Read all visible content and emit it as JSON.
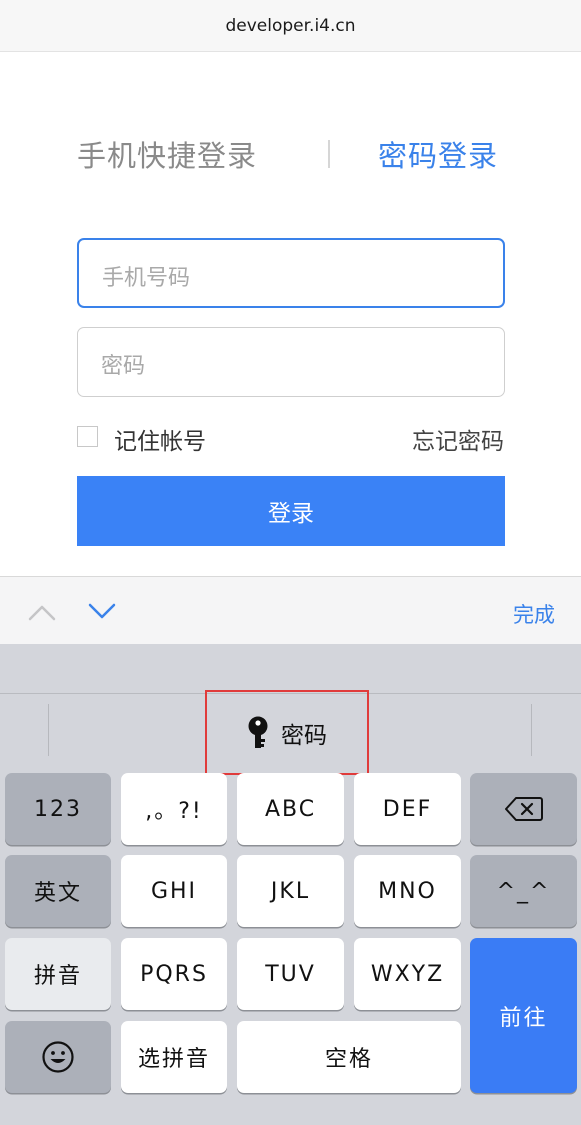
{
  "browser": {
    "url": "developer.i4.cn"
  },
  "login": {
    "tab_quick": "手机快捷登录",
    "tab_password": "密码登录",
    "phone_placeholder": "手机号码",
    "password_placeholder": "密码",
    "remember_label": "记住帐号",
    "forgot_label": "忘记密码",
    "login_button": "登录"
  },
  "accessory": {
    "done_label": "完成"
  },
  "keyboard": {
    "suggestion": "密码",
    "keys": {
      "num": "123",
      "punct": ",。?!",
      "abc": "ABC",
      "def": "DEF",
      "english": "英文",
      "ghi": "GHI",
      "jkl": "JKL",
      "mno": "MNO",
      "emoticon": "^_^",
      "pinyin": "拼音",
      "pqrs": "PQRS",
      "tuv": "TUV",
      "wxyz": "WXYZ",
      "go": "前往",
      "select_pinyin": "选拼音",
      "space": "空格"
    }
  },
  "colors": {
    "accent": "#3a82ea",
    "button": "#3a82f6",
    "highlight": "#e03b3b"
  }
}
